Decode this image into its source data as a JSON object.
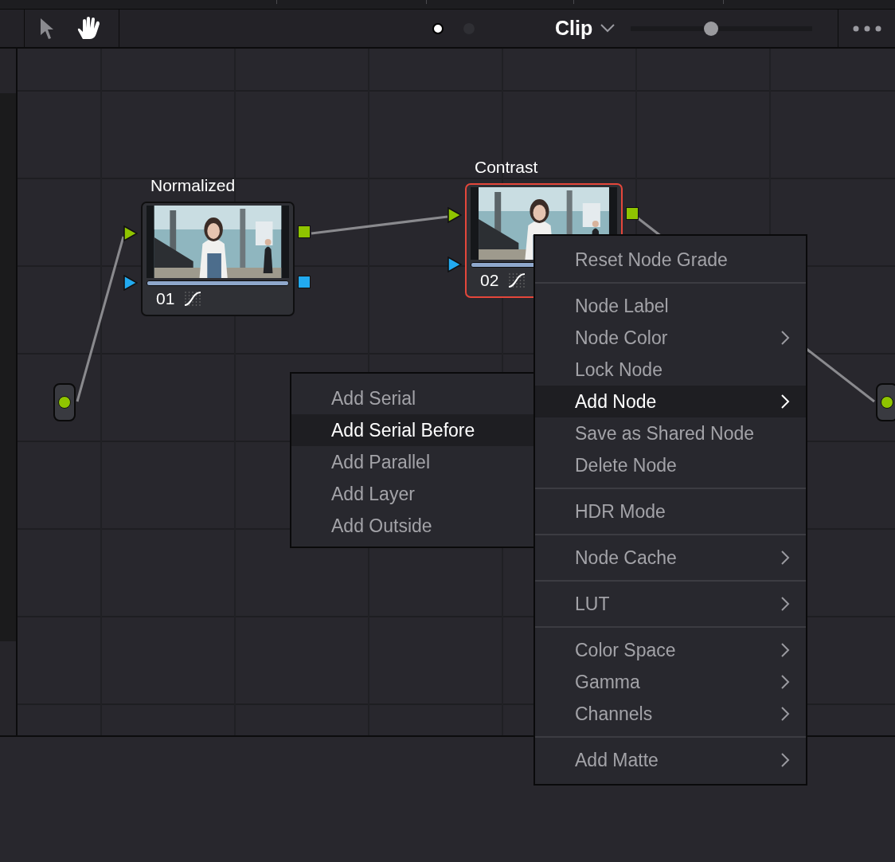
{
  "toolbar": {
    "tools": [
      {
        "kind": "pointer",
        "selected": false
      },
      {
        "kind": "hand",
        "selected": true
      }
    ],
    "page_dots": [
      {
        "selected": true
      },
      {
        "selected": false
      }
    ],
    "title": "Clip",
    "zoom_slider": {
      "level": 0.44
    }
  },
  "nodes": [
    {
      "label": "Normalized",
      "number": "01",
      "selected": false
    },
    {
      "label": "Contrast",
      "number": "02",
      "selected": true
    }
  ],
  "context_menu": {
    "groups": [
      [
        {
          "label": "Reset Node Grade",
          "submenu": false,
          "selected": false
        }
      ],
      [
        {
          "label": "Node Label",
          "submenu": false,
          "selected": false
        },
        {
          "label": "Node Color",
          "submenu": true,
          "selected": false
        },
        {
          "label": "Lock Node",
          "submenu": false,
          "selected": false
        },
        {
          "label": "Add Node",
          "submenu": true,
          "selected": true
        },
        {
          "label": "Save as Shared Node",
          "submenu": false,
          "selected": false
        },
        {
          "label": "Delete Node",
          "submenu": false,
          "selected": false
        }
      ],
      [
        {
          "label": "HDR Mode",
          "submenu": false,
          "selected": false
        }
      ],
      [
        {
          "label": "Node Cache",
          "submenu": true,
          "selected": false
        }
      ],
      [
        {
          "label": "LUT",
          "submenu": true,
          "selected": false
        }
      ],
      [
        {
          "label": "Color Space",
          "submenu": true,
          "selected": false
        },
        {
          "label": "Gamma",
          "submenu": true,
          "selected": false
        },
        {
          "label": "Channels",
          "submenu": true,
          "selected": false
        }
      ],
      [
        {
          "label": "Add Matte",
          "submenu": true,
          "selected": false
        }
      ]
    ]
  },
  "submenu": {
    "items": [
      {
        "label": "Add Serial",
        "selected": false
      },
      {
        "label": "Add Serial Before",
        "selected": true
      },
      {
        "label": "Add Parallel",
        "selected": false
      },
      {
        "label": "Add Layer",
        "selected": false
      },
      {
        "label": "Add Outside",
        "selected": false
      }
    ]
  }
}
